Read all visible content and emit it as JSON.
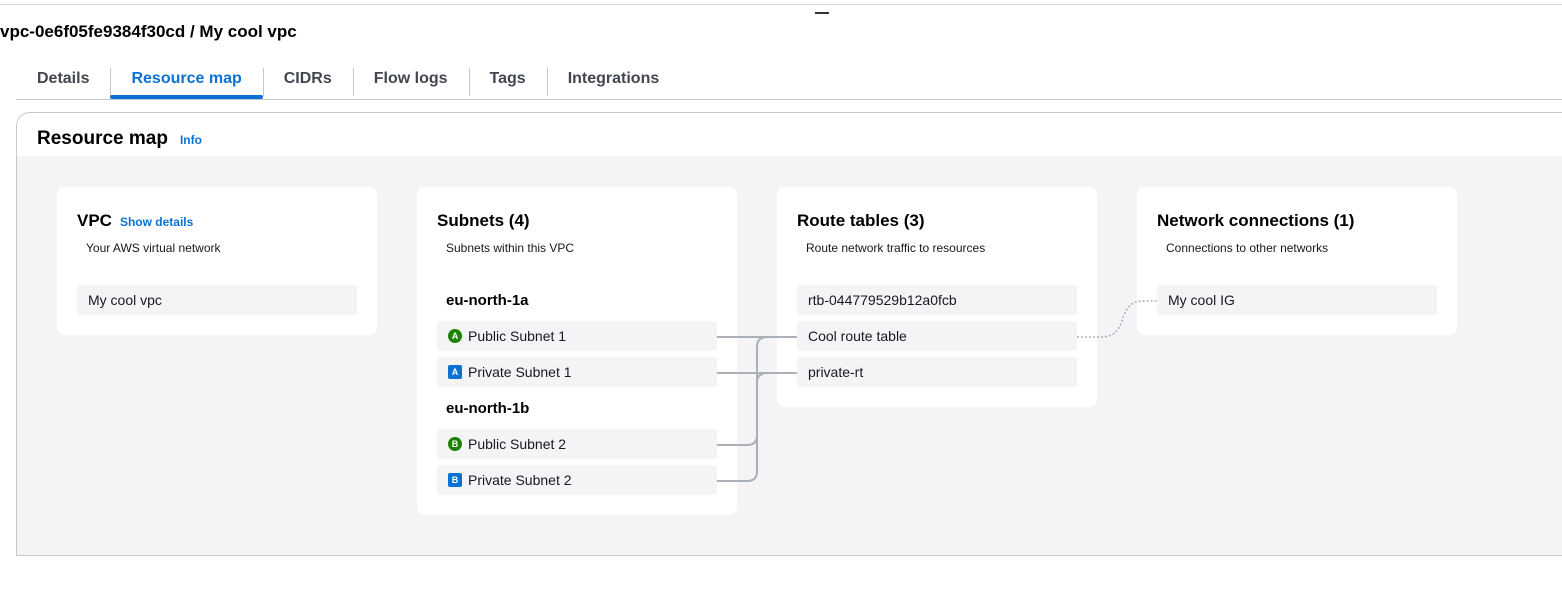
{
  "title": "vpc-0e6f05fe9384f30cd / My cool vpc",
  "tabs": [
    "Details",
    "Resource map",
    "CIDRs",
    "Flow logs",
    "Tags",
    "Integrations"
  ],
  "active_tab": "Resource map",
  "panel": {
    "title": "Resource map",
    "info": "Info"
  },
  "vpc": {
    "title": "VPC",
    "link": "Show details",
    "subtitle": "Your AWS virtual network",
    "items": [
      "My cool vpc"
    ]
  },
  "subnets": {
    "title": "Subnets (4)",
    "subtitle": "Subnets within this VPC",
    "zones": [
      {
        "name": "eu-north-1a",
        "items": [
          {
            "label": "Public Subnet 1",
            "badge": "A",
            "type": "public"
          },
          {
            "label": "Private Subnet 1",
            "badge": "A",
            "type": "private"
          }
        ]
      },
      {
        "name": "eu-north-1b",
        "items": [
          {
            "label": "Public Subnet 2",
            "badge": "B",
            "type": "public"
          },
          {
            "label": "Private Subnet 2",
            "badge": "B",
            "type": "private"
          }
        ]
      }
    ]
  },
  "route_tables": {
    "title": "Route tables (3)",
    "subtitle": "Route network traffic to resources",
    "items": [
      "rtb-044779529b12a0fcb",
      "Cool route table",
      "private-rt"
    ]
  },
  "network": {
    "title": "Network connections (1)",
    "subtitle": "Connections to other networks",
    "items": [
      "My cool IG"
    ]
  },
  "colors": {
    "accent": "#0972d3",
    "public": "#1d8102",
    "private": "#0972d3"
  }
}
